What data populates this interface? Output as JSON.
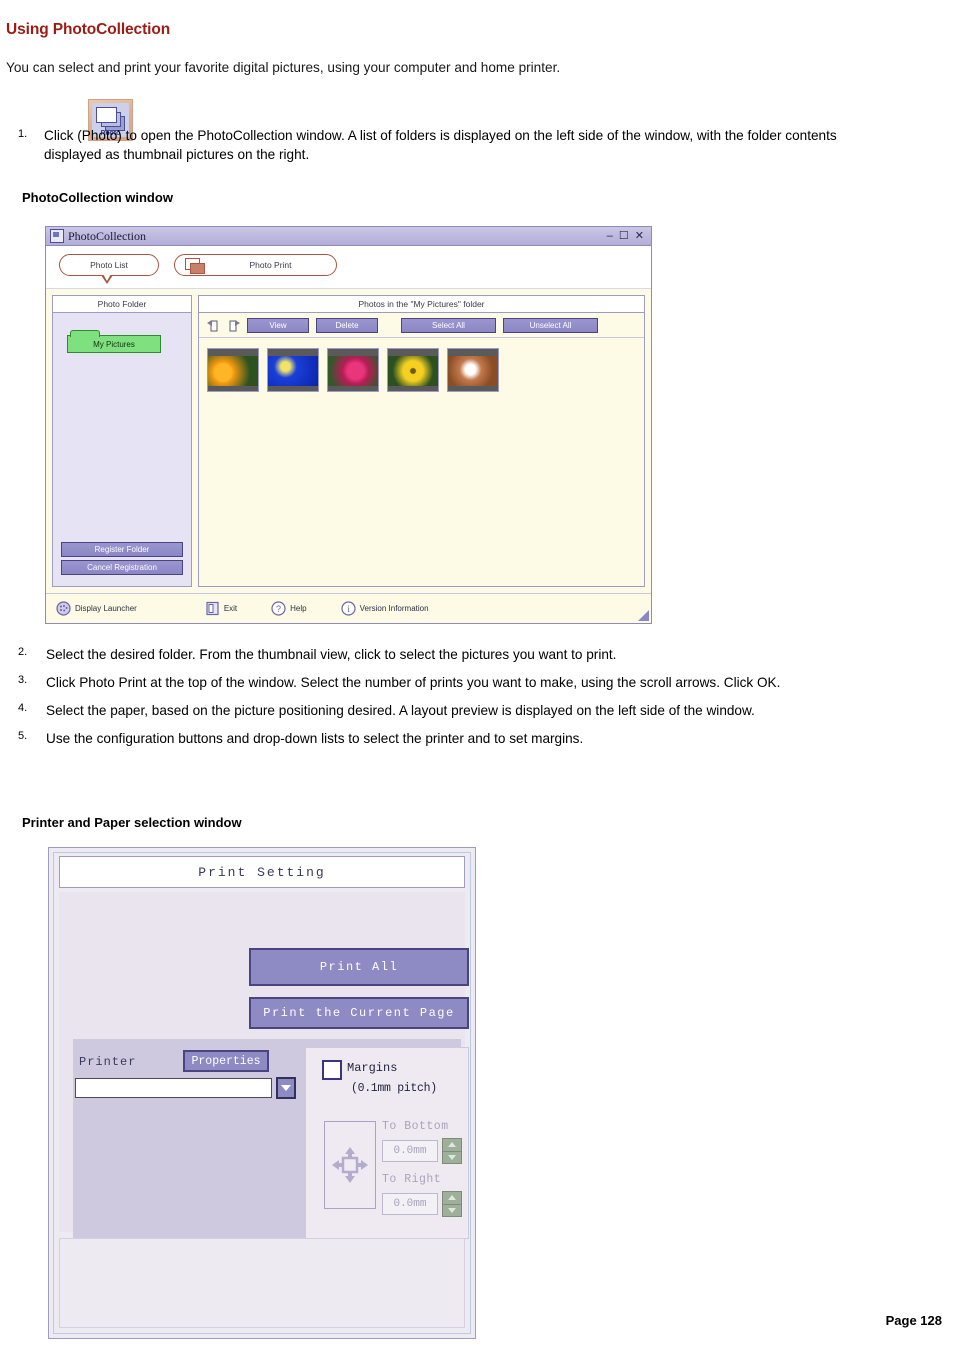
{
  "document": {
    "title": "Using PhotoCollection",
    "intro": "You can select and print your favorite digital pictures, using your computer and home printer.",
    "footer": "Page 128",
    "title_color": "#9e1b14"
  },
  "step_one": {
    "number": "1.",
    "text": "Click          (Photo) to open the PhotoCollection window. A list of folders is displayed on the left side of the window, with the folder contents displayed as thumbnail pictures on the right.",
    "icon_label": "Photo"
  },
  "captions": {
    "photocollection": "PhotoCollection window",
    "printer": "Printer and Paper selection window"
  },
  "steps": [
    {
      "number": "2.",
      "text": "Select the desired folder. From the thumbnail view, click to select the pictures you want to print."
    },
    {
      "number": "3.",
      "text": "Click Photo Print at the top of the window. Select the number of prints you want to make, using the scroll arrows. Click OK."
    },
    {
      "number": "4.",
      "text": "Select the paper, based on the picture positioning desired. A layout preview is displayed on the left side of the window."
    },
    {
      "number": "5.",
      "text": "Use the configuration buttons and drop-down lists to select the printer and to set margins."
    }
  ],
  "photocollection_window": {
    "title": "PhotoCollection",
    "window_buttons": {
      "minimize": "–",
      "maximize": "☐",
      "close": "✕"
    },
    "tabs": [
      {
        "label": "Photo List",
        "active": true
      },
      {
        "label": "Photo Print",
        "active": false
      }
    ],
    "left_panel": {
      "header": "Photo Folder",
      "folder": "My Pictures",
      "buttons": [
        {
          "label": "Register Folder"
        },
        {
          "label": "Cancel Registration"
        }
      ]
    },
    "right_panel": {
      "header": "Photos in the \"My Pictures\" folder",
      "toolbar": [
        {
          "label": "View"
        },
        {
          "label": "Delete"
        },
        {
          "label": "Select All"
        },
        {
          "label": "Unselect All"
        }
      ],
      "thumbnails": [
        {
          "alt": "orange-flowers"
        },
        {
          "alt": "yellow-shapes-on-blue"
        },
        {
          "alt": "pink-roses"
        },
        {
          "alt": "yellow-sunflower"
        },
        {
          "alt": "dog-portrait"
        }
      ]
    },
    "status_bar": [
      {
        "label": "Display Launcher",
        "icon": "launcher-icon"
      },
      {
        "label": "Exit",
        "icon": "exit-icon"
      },
      {
        "label": "Help",
        "icon": "help-icon"
      },
      {
        "label": "Version Information",
        "icon": "info-icon"
      }
    ],
    "accent_color": "#8b86c6",
    "canvas_color": "#fdfbe6",
    "titlebar_color": "#bcb8df"
  },
  "print_setting_window": {
    "title": "Print Setting",
    "buttons": [
      {
        "label": "Print All"
      },
      {
        "label": "Print the Current Page"
      }
    ],
    "printer": {
      "label": "Printer",
      "properties_label": "Properties",
      "selected_value": "",
      "placeholder": ""
    },
    "margins": {
      "checkbox_label": "Margins",
      "pitch_note": "(0.1mm pitch)",
      "checked": false,
      "fields": [
        {
          "label": "To Bottom",
          "value": "0.0mm"
        },
        {
          "label": "To Right",
          "value": "0.0mm"
        }
      ]
    },
    "accent_color": "#8e8ac4",
    "spinner_color": "#9fb09a"
  }
}
